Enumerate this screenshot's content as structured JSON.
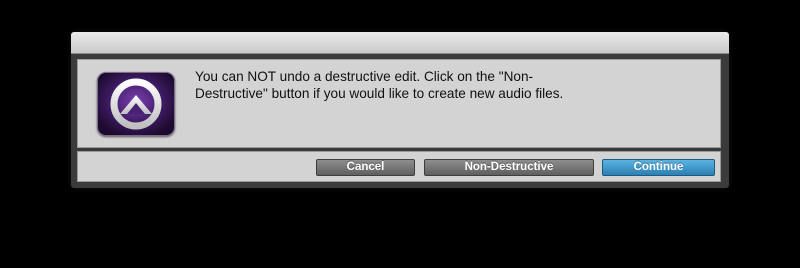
{
  "dialog": {
    "message": "You can NOT undo a destructive edit.  Click on the \"Non-\nDestructive\" button if you would like to create new audio files.",
    "app_icon": "pro-tools-logo-icon"
  },
  "buttons": {
    "cancel_label": "Cancel",
    "non_destructive_label": "Non-Destructive",
    "continue_label": "Continue"
  },
  "colors": {
    "background": "#000000",
    "panel": "#d3d3d3",
    "button_gray": "#6e6e6e",
    "button_default_blue": "#3d94c9",
    "icon_purple": "#2a1440"
  }
}
